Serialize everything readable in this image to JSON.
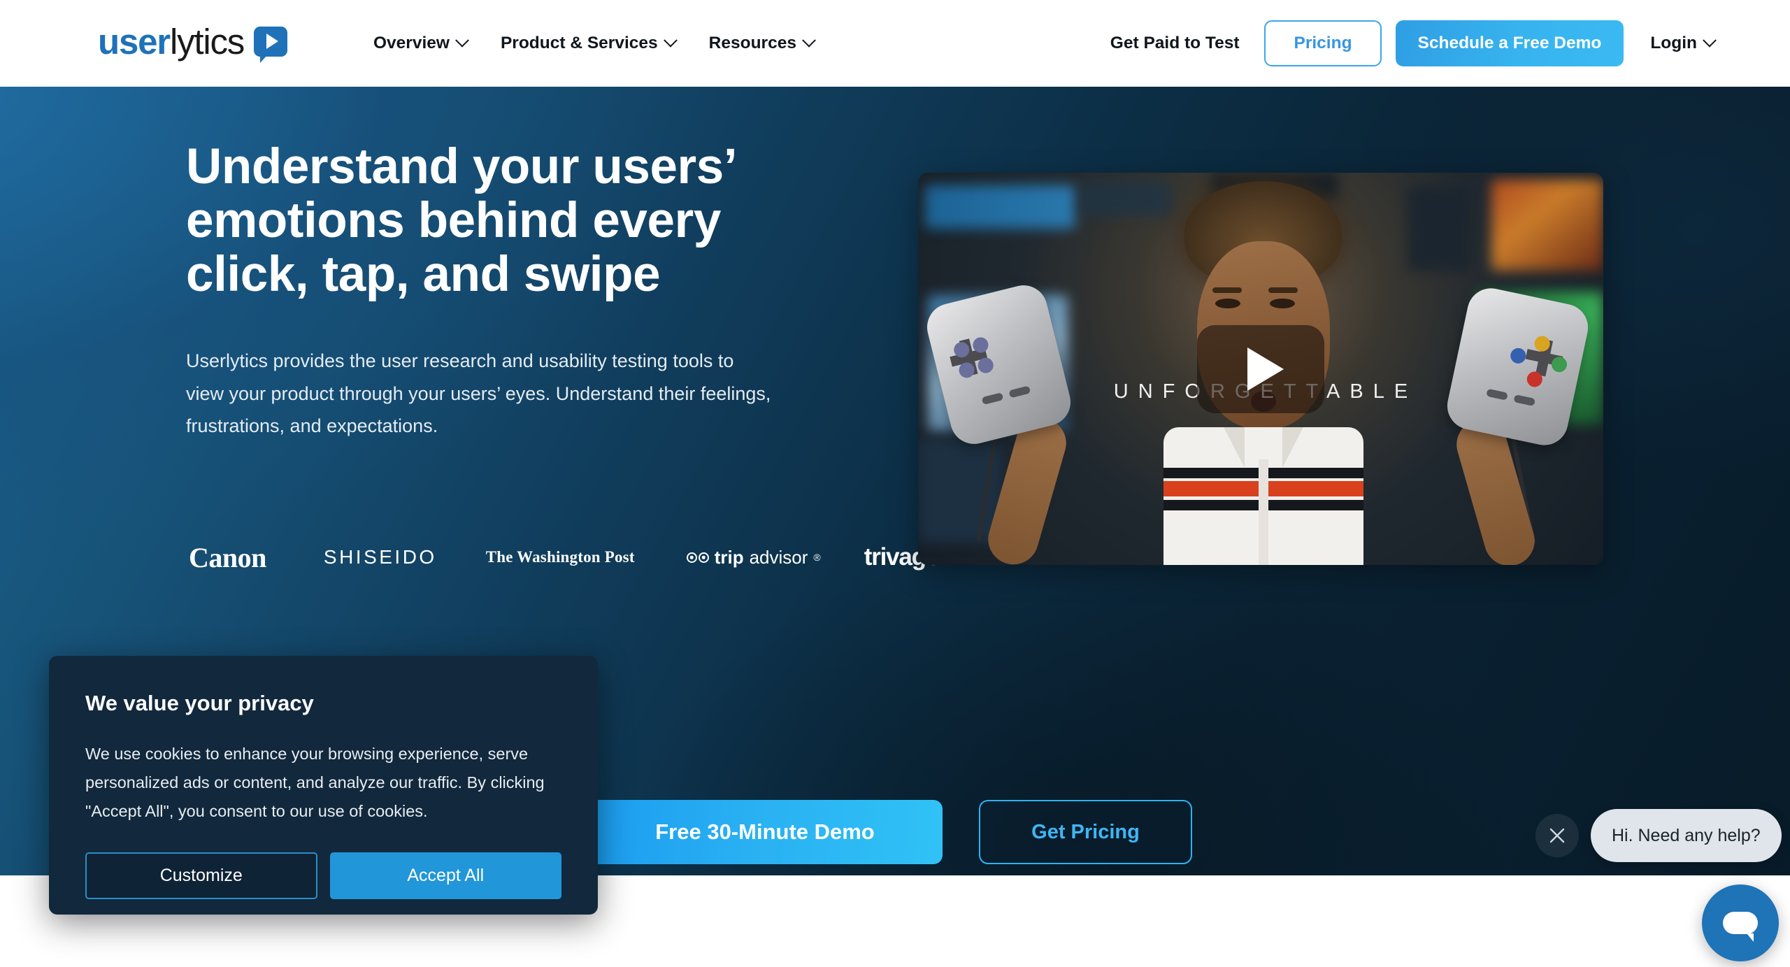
{
  "brand": {
    "logo_primary": "user",
    "logo_secondary": "lytics",
    "logo_icon": "play-bubble-icon",
    "accent_blue": "#1f72b8",
    "cta_blue": "#2bb3f3",
    "dark_navy": "#0a2233"
  },
  "header": {
    "nav": [
      {
        "label": "Overview",
        "has_dropdown": true
      },
      {
        "label": "Product & Services",
        "has_dropdown": true
      },
      {
        "label": "Resources",
        "has_dropdown": true
      }
    ],
    "get_paid_label": "Get Paid to Test",
    "pricing_label": "Pricing",
    "schedule_demo_label": "Schedule a Free Demo",
    "login_label": "Login"
  },
  "hero": {
    "title": "Understand your users’\nemotions behind every\nclick, tap, and swipe",
    "subtitle": "Userlytics provides the user research and usability testing tools to\nview your product through your users’ eyes. Understand their feelings,\nfrustrations, and expectations.",
    "cta_primary": "Free 30-Minute Demo",
    "cta_secondary": "Get Pricing",
    "brands": [
      {
        "name": "Canon"
      },
      {
        "name": "SHISEIDO"
      },
      {
        "name": "The Washington Post"
      },
      {
        "name": "tripadvisor",
        "bold_part": "trip",
        "light_part": "advisor",
        "mark": "®"
      },
      {
        "name": "trivago"
      }
    ]
  },
  "video": {
    "overlay_title": "UNFORGETTABLE",
    "play_label": "play-button"
  },
  "cookie_banner": {
    "title": "We value your privacy",
    "body": "We use cookies to enhance your browsing experience, serve personalized ads or content, and analyze our traffic. By clicking \"Accept All\", you consent to our use of cookies.",
    "customize_label": "Customize",
    "accept_all_label": "Accept All"
  },
  "chat": {
    "prompt": "Hi. Need any help?",
    "close_label": "close-icon",
    "fab_label": "chat-icon"
  }
}
